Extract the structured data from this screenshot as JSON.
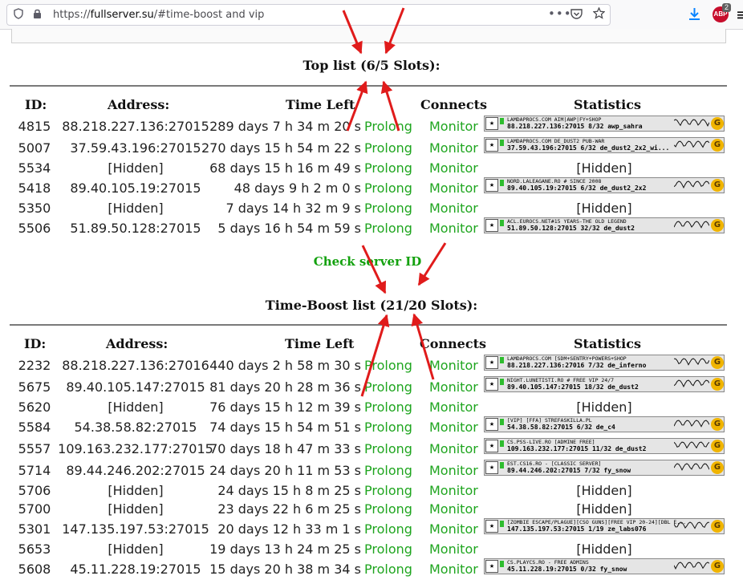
{
  "browser": {
    "url_scheme": "https://",
    "url_host": "fullserver.su",
    "url_path": "/#time-boost and vip",
    "abp_label": "ABP",
    "abp_count": "2",
    "icons": [
      "shield-icon",
      "lock-icon",
      "more-icon",
      "pocket-icon",
      "bookmark-star-icon",
      "download-icon",
      "adblock-icon",
      "menu-icon"
    ]
  },
  "top_list": {
    "title": "Top list (6/5 Slots):",
    "headers": {
      "id": "ID:",
      "address": "Address:",
      "time_left": "Time Left",
      "connects": "Connects",
      "statistics": "Statistics"
    },
    "rows": [
      {
        "id": "4815",
        "address": "88.218.227.136:27015",
        "time": "289 days 7 h 34 m 20 s",
        "prolong": "Prolong",
        "monitor": "Monitor",
        "stats": {
          "banner": true,
          "line1": "LAMDAPROCS.COM AIM|AWP|FY+SHOP",
          "line2": "88.218.227.136:27015   8/32   awp_sahra"
        }
      },
      {
        "id": "5007",
        "address": "37.59.43.196:27015",
        "time": "270 days 15 h 54 m 22 s",
        "prolong": "Prolong",
        "monitor": "Monitor",
        "stats": {
          "banner": true,
          "line1": "LAMDAPROCS.COM DE_DUST2 PUB-WAR",
          "line2": "37.59.43.196:27015   6/32   de_dust2_2x2_wi..."
        }
      },
      {
        "id": "5534",
        "address": "[Hidden]",
        "time": "68 days 15 h 16 m 49 s",
        "prolong": "Prolong",
        "monitor": "Monitor",
        "stats": {
          "banner": false,
          "text": "[Hidden]"
        }
      },
      {
        "id": "5418",
        "address": "89.40.105.19:27015",
        "time": "48 days 9 h 2 m 0 s",
        "prolong": "Prolong",
        "monitor": "Monitor",
        "stats": {
          "banner": true,
          "line1": "NORD.LALEAGANE.RO # SINCE 2008",
          "line2": "89.40.105.19:27015   6/32   de_dust2_2x2"
        }
      },
      {
        "id": "5350",
        "address": "[Hidden]",
        "time": "7 days 14 h 32 m 9 s",
        "prolong": "Prolong",
        "monitor": "Monitor",
        "stats": {
          "banner": false,
          "text": "[Hidden]"
        }
      },
      {
        "id": "5506",
        "address": "51.89.50.128:27015",
        "time": "5 days 16 h 54 m 59 s",
        "prolong": "Prolong",
        "monitor": "Monitor",
        "stats": {
          "banner": true,
          "line1": "ACL.EUROCS.NET#15 YEARS-THE OLD LEGEND",
          "line2": "51.89.50.128:27015   32/32   de_dust2"
        }
      }
    ]
  },
  "check_server": "Check server ID",
  "boost_list": {
    "title": "Time-Boost list (21/20 Slots):",
    "headers": {
      "id": "ID:",
      "address": "Address:",
      "time_left": "Time Left",
      "connects": "Connects",
      "statistics": "Statistics"
    },
    "rows": [
      {
        "id": "2232",
        "address": "88.218.227.136:27016",
        "time": "440 days 2 h 58 m 30 s",
        "prolong": "Prolong",
        "monitor": "Monitor",
        "stats": {
          "banner": true,
          "line1": "LAMDAPROCS.COM [SDM+SENTRY+POWERS+SHOP",
          "line2": "88.218.227.136:27016   7/32   de_inferno"
        }
      },
      {
        "id": "5675",
        "address": "89.40.105.147:27015",
        "time": "81 days 20 h 28 m 36 s",
        "prolong": "Prolong",
        "monitor": "Monitor",
        "stats": {
          "banner": true,
          "line1": "NIGHT.LUNETISTI.RO # FREE VIP 24/7",
          "line2": "89.40.105.147:27015   18/32   de_dust2"
        }
      },
      {
        "id": "5620",
        "address": "[Hidden]",
        "time": "76 days 15 h 12 m 39 s",
        "prolong": "Prolong",
        "monitor": "Monitor",
        "stats": {
          "banner": false,
          "text": "[Hidden]"
        }
      },
      {
        "id": "5584",
        "address": "54.38.58.82:27015",
        "time": "74 days 15 h 54 m 51 s",
        "prolong": "Prolong",
        "monitor": "Monitor",
        "stats": {
          "banner": true,
          "line1": "[VIP] [FFA] STREFASKILLA.PL",
          "line2": "54.38.58.82:27015   6/32   de_c4"
        }
      },
      {
        "id": "5557",
        "address": "109.163.232.177:27015",
        "time": "70 days 18 h 47 m 33 s",
        "prolong": "Prolong",
        "monitor": "Monitor",
        "stats": {
          "banner": true,
          "line1": "CS.PSS-LIVE.RO [ADMINE FREE]",
          "line2": "109.163.232.177:27015   11/32   de_dust2"
        }
      },
      {
        "id": "5714",
        "address": "89.44.246.202:27015",
        "time": "24 days 20 h 11 m 53 s",
        "prolong": "Prolong",
        "monitor": "Monitor",
        "stats": {
          "banner": true,
          "line1": "EST.CS16.RO - [CLASSIC SERVER]",
          "line2": "89.44.246.202:27015   7/32   fy_snow"
        }
      },
      {
        "id": "5706",
        "address": "[Hidden]",
        "time": "24 days 15 h 8 m 25 s",
        "prolong": "Prolong",
        "monitor": "Monitor",
        "stats": {
          "banner": false,
          "text": "[Hidden]"
        }
      },
      {
        "id": "5700",
        "address": "[Hidden]",
        "time": "23 days 22 h 6 m 25 s",
        "prolong": "Prolong",
        "monitor": "Monitor",
        "stats": {
          "banner": false,
          "text": "[Hidden]"
        }
      },
      {
        "id": "5301",
        "address": "147.135.197.53:27015",
        "time": "20 days 12 h 33 m 1 s",
        "prolong": "Prolong",
        "monitor": "Monitor",
        "stats": {
          "banner": true,
          "line1": "[ZOMBIE ESCAPE/PLAGUE][CSO GUNS][FREE VIP 20-24][DBL E...",
          "line2": "147.135.197.53:27015   1/19   ze_labs076"
        }
      },
      {
        "id": "5653",
        "address": "[Hidden]",
        "time": "19 days 13 h 24 m 25 s",
        "prolong": "Prolong",
        "monitor": "Monitor",
        "stats": {
          "banner": false,
          "text": "[Hidden]"
        }
      },
      {
        "id": "5608",
        "address": "45.11.228.19:27015",
        "time": "15 days 20 h 38 m 34 s",
        "prolong": "Prolong",
        "monitor": "Monitor",
        "stats": {
          "banner": true,
          "line1": "CS.PLAYCS.RO - FREE ADMINS",
          "line2": "45.11.228.19:27015   0/32   fy_snow"
        }
      }
    ]
  },
  "colors": {
    "link_green": "#1fa51f",
    "annotation_red": "#e01b1b",
    "status_green": "#2ebd2e"
  }
}
